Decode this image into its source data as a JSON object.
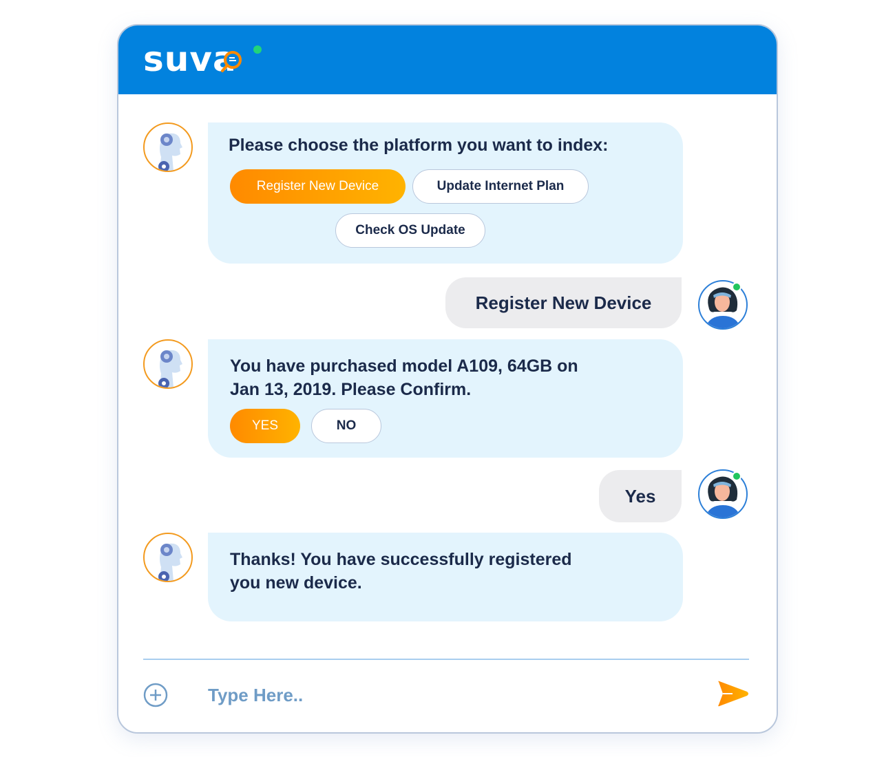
{
  "header": {
    "brand": "SUVA",
    "logo_text": "suva",
    "status": "online",
    "colors": {
      "header_bg": "#0282de",
      "online": "#22d47a"
    }
  },
  "conversation": [
    {
      "sender": "bot",
      "avatar": "robot-avatar",
      "text": "Please choose the platform you want to index:",
      "options": [
        {
          "label": "Register New Device",
          "selected": true
        },
        {
          "label": "Update Internet Plan",
          "selected": false
        },
        {
          "label": "Check OS Update",
          "selected": false
        }
      ]
    },
    {
      "sender": "user",
      "avatar": "user-avatar",
      "online": true,
      "text": "Register New Device"
    },
    {
      "sender": "bot",
      "avatar": "robot-avatar",
      "text_lines": [
        "You have purchased model A109, 64GB on",
        "Jan 13, 2019. Please Confirm."
      ],
      "options": [
        {
          "label": "YES",
          "selected": true
        },
        {
          "label": "NO",
          "selected": false
        }
      ]
    },
    {
      "sender": "user",
      "avatar": "user-avatar",
      "online": true,
      "text": "Yes"
    },
    {
      "sender": "bot",
      "avatar": "robot-avatar",
      "text_lines": [
        "Thanks! You have successfully registered",
        "you new device."
      ]
    }
  ],
  "composer": {
    "placeholder": "Type Here..",
    "value": "",
    "attach_icon": "plus-circle-icon",
    "send_icon": "send-arrow-icon"
  },
  "colors": {
    "accent_gradient_start": "#ff8a00",
    "accent_gradient_end": "#ffb300",
    "bot_bubble": "#e3f4fd",
    "user_bubble": "#ececee",
    "text": "#1b2a4a",
    "placeholder": "#6f9cc6"
  }
}
